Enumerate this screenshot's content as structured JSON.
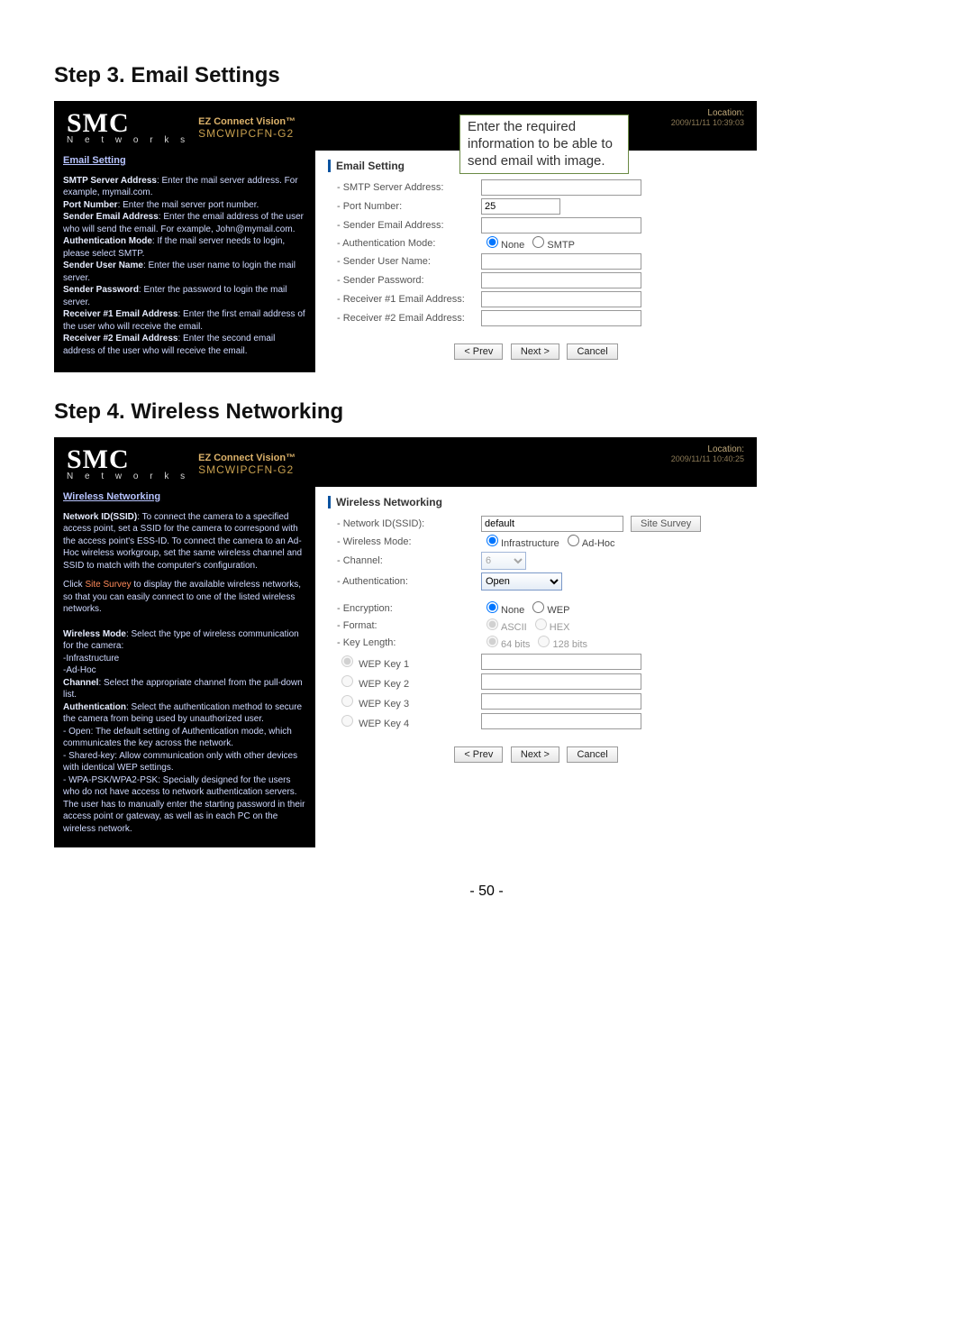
{
  "page_number": "- 50 -",
  "step3": {
    "title": "Step 3. Email Settings",
    "location_label": "Location:",
    "location_time": "2009/11/11 10:39:03",
    "brand": {
      "smc": "SMC",
      "networks": "N e t w o r k s",
      "line1": "EZ Connect Vision™",
      "line2": "SMCWIPCFN-G2"
    },
    "sidebar": {
      "title": "Email Setting",
      "items": [
        {
          "b": "SMTP Server Address",
          "t": ": Enter the mail server address. For example, mymail.com."
        },
        {
          "b": "Port Number",
          "t": ": Enter the mail server port number."
        },
        {
          "b": "Sender Email Address",
          "t": ": Enter the email address of the user who will send the email. For example, John@mymail.com."
        },
        {
          "b": "Authentication Mode",
          "t": ": If the mail server needs to login, please select SMTP."
        },
        {
          "b": "Sender User Name",
          "t": ": Enter the user name to login the mail server."
        },
        {
          "b": "Sender Password",
          "t": ": Enter the password to login the mail server."
        },
        {
          "b": "Receiver #1 Email Address",
          "t": ": Enter the first email address of the user who will receive the email."
        },
        {
          "b": "Receiver #2 Email Address",
          "t": ": Enter the second email address of the user who will receive the email."
        }
      ]
    },
    "form": {
      "section": "Email Setting",
      "rows": [
        {
          "label": "- SMTP Server Address:",
          "value": ""
        },
        {
          "label": "- Port Number:",
          "value": "25"
        },
        {
          "label": "- Sender Email Address:",
          "value": ""
        },
        {
          "label": "- Authentication Mode:",
          "radios": [
            "None",
            "SMTP"
          ],
          "checked": 0
        },
        {
          "label": "- Sender User Name:",
          "value": ""
        },
        {
          "label": "- Sender Password:",
          "value": ""
        },
        {
          "label": "- Receiver #1 Email Address:",
          "value": ""
        },
        {
          "label": "- Receiver #2 Email Address:",
          "value": ""
        }
      ],
      "buttons": {
        "prev": "< Prev",
        "next": "Next >",
        "cancel": "Cancel"
      }
    },
    "callout": "Enter the required information to be able to send email with image."
  },
  "step4": {
    "title": "Step 4. Wireless Networking",
    "location_label": "Location:",
    "location_time": "2009/11/11 10:40:25",
    "brand": {
      "smc": "SMC",
      "networks": "N e t w o r k s",
      "line1": "EZ Connect Vision™",
      "line2": "SMCWIPCFN-G2"
    },
    "sidebar": {
      "title": "Wireless Networking",
      "blocks": [
        {
          "b": "Network ID(SSID)",
          "t": ": To connect the camera to a specified access point, set a SSID for the camera to correspond with the access point's ESS-ID. To connect the camera to an Ad-Hoc wireless workgroup, set the same wireless channel and SSID to match with the computer's configuration."
        },
        {
          "plain": "Click ",
          "hl": "Site Survey",
          "t2": " to display the available wireless networks, so that you can easily connect to one of the listed wireless networks."
        },
        {
          "b": "Wireless Mode",
          "t": ": Select the type of wireless communication for the camera:"
        },
        {
          "sub": "-Infrastructure"
        },
        {
          "sub": "-Ad-Hoc"
        },
        {
          "b": "Channel",
          "t": ": Select the appropriate channel from the pull-down list."
        },
        {
          "b": "Authentication",
          "t": ": Select the authentication method to secure the camera from being used by unauthorized user."
        },
        {
          "sub2": "- Open: The default setting of Authentication mode, which communicates the key across the network."
        },
        {
          "sub2": "- Shared-key: Allow communication only with other devices with identical WEP settings."
        },
        {
          "sub2": "- WPA-PSK/WPA2-PSK: Specially designed for the users who do not have access to network authentication servers. The user has to manually enter the starting password in their access point or gateway, as well as in each PC on the wireless network."
        }
      ]
    },
    "form": {
      "section": "Wireless Networking",
      "ssid_label": "- Network ID(SSID):",
      "ssid_value": "default",
      "site_survey": "Site Survey",
      "mode_label": "- Wireless Mode:",
      "mode_radios": [
        "Infrastructure",
        "Ad-Hoc"
      ],
      "channel_label": "- Channel:",
      "channel_value": "6",
      "auth_label": "- Authentication:",
      "auth_value": "Open",
      "enc_label": "- Encryption:",
      "enc_radios": [
        "None",
        "WEP"
      ],
      "fmt_label": "- Format:",
      "fmt_radios": [
        "ASCII",
        "HEX"
      ],
      "keylen_label": "- Key Length:",
      "keylen_radios": [
        "64 bits",
        "128 bits"
      ],
      "wep_labels": [
        "WEP Key 1",
        "WEP Key 2",
        "WEP Key 3",
        "WEP Key 4"
      ],
      "buttons": {
        "prev": "< Prev",
        "next": "Next >",
        "cancel": "Cancel"
      }
    }
  }
}
